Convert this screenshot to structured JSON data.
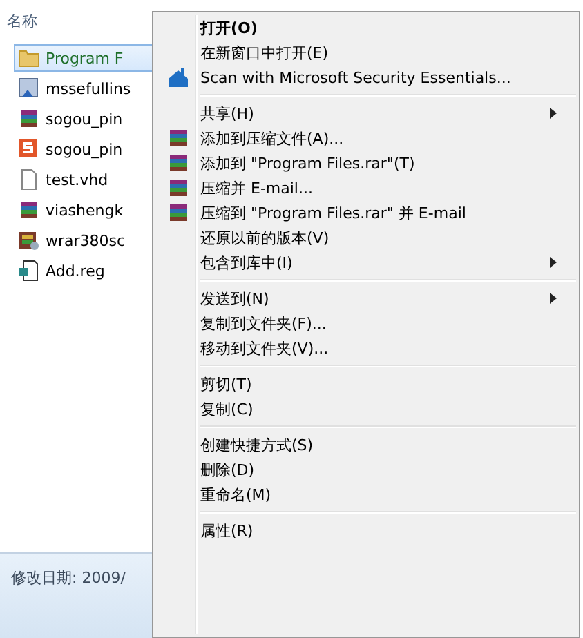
{
  "file_list": {
    "column_header": "名称",
    "files": [
      {
        "name": "Program F",
        "kind": "folder",
        "selected": true
      },
      {
        "name": "mssefullins",
        "kind": "installer",
        "selected": false
      },
      {
        "name": "sogou_pin",
        "kind": "archive",
        "selected": false
      },
      {
        "name": "sogou_pin",
        "kind": "sogou",
        "selected": false
      },
      {
        "name": "test.vhd",
        "kind": "file",
        "selected": false
      },
      {
        "name": "viashengk",
        "kind": "archive",
        "selected": false
      },
      {
        "name": "wrar380sc",
        "kind": "sfx",
        "selected": false
      },
      {
        "name": "Add.reg",
        "kind": "reg",
        "selected": false
      }
    ]
  },
  "status_bar": {
    "text": "修改日期: 2009/"
  },
  "context_menu": {
    "groups": [
      [
        {
          "label": "打开(O)",
          "default": true,
          "submenu": false
        },
        {
          "label": "在新窗口中打开(E)",
          "default": false,
          "submenu": false
        },
        {
          "label": "Scan with Microsoft Security Essentials...",
          "kind": "antivirus",
          "default": false,
          "submenu": false
        }
      ],
      [
        {
          "label": "共享(H)",
          "default": false,
          "submenu": true
        },
        {
          "label": "添加到压缩文件(A)...",
          "kind": "archive",
          "default": false,
          "submenu": false
        },
        {
          "label": "添加到 \"Program Files.rar\"(T)",
          "kind": "archive",
          "default": false,
          "submenu": false
        },
        {
          "label": "压缩并 E-mail...",
          "kind": "archive",
          "default": false,
          "submenu": false
        },
        {
          "label": "压缩到 \"Program Files.rar\" 并 E-mail",
          "kind": "archive",
          "default": false,
          "submenu": false
        },
        {
          "label": "还原以前的版本(V)",
          "default": false,
          "submenu": false
        },
        {
          "label": "包含到库中(I)",
          "default": false,
          "submenu": true
        }
      ],
      [
        {
          "label": "发送到(N)",
          "default": false,
          "submenu": true
        },
        {
          "label": "复制到文件夹(F)...",
          "default": false,
          "submenu": false
        },
        {
          "label": "移动到文件夹(V)...",
          "default": false,
          "submenu": false
        }
      ],
      [
        {
          "label": "剪切(T)",
          "default": false,
          "submenu": false
        },
        {
          "label": "复制(C)",
          "default": false,
          "submenu": false
        }
      ],
      [
        {
          "label": "创建快捷方式(S)",
          "default": false,
          "submenu": false
        },
        {
          "label": "删除(D)",
          "default": false,
          "submenu": false
        },
        {
          "label": "重命名(M)",
          "default": false,
          "submenu": false
        }
      ],
      [
        {
          "label": "属性(R)",
          "default": false,
          "submenu": false
        }
      ]
    ]
  }
}
